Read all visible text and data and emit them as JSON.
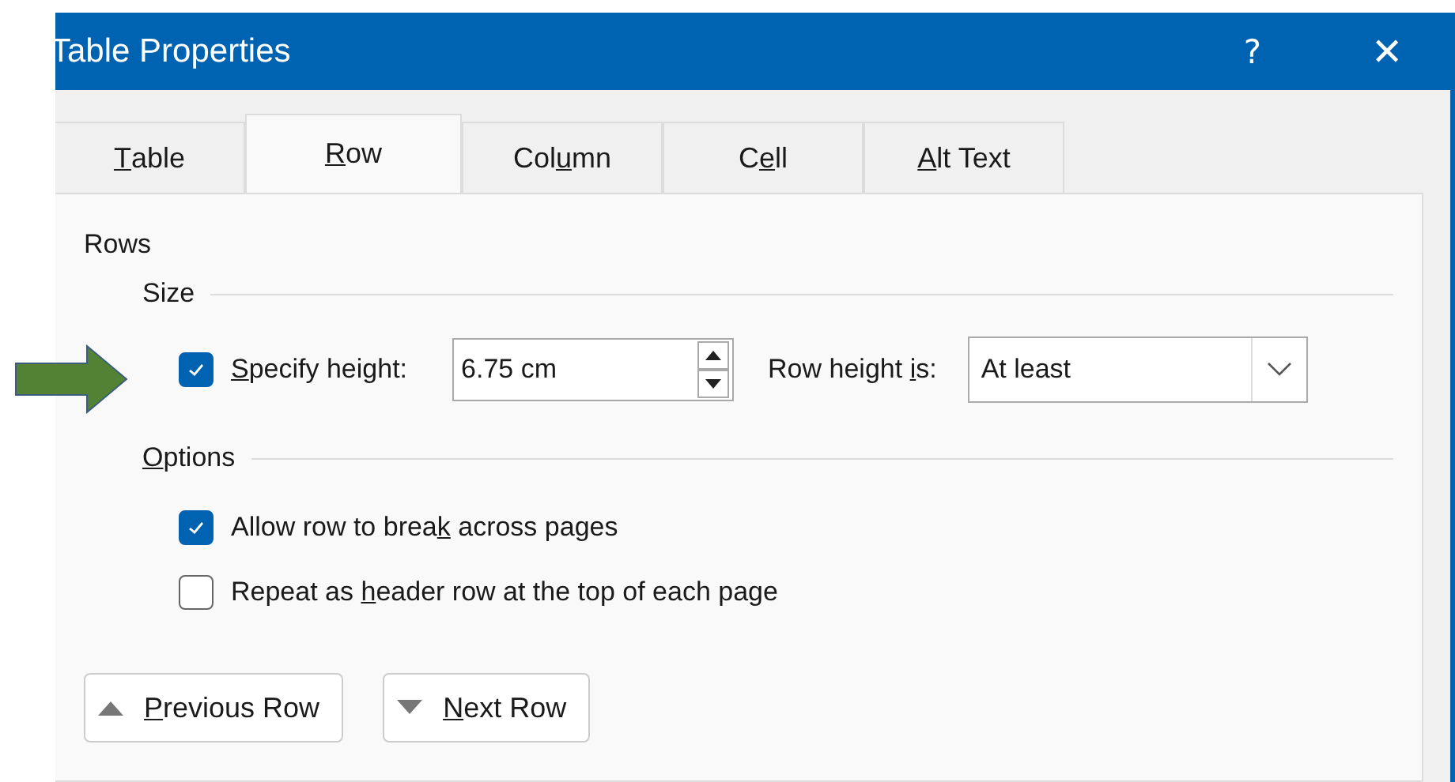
{
  "window": {
    "title": "Table Properties",
    "help": "?",
    "close": "✕"
  },
  "tabs": [
    {
      "key": "T",
      "post": "able",
      "selected": false
    },
    {
      "key": "R",
      "post": "ow",
      "selected": true
    },
    {
      "pre": "Col",
      "key": "u",
      "post": "mn",
      "selected": false
    },
    {
      "pre": "C",
      "key": "e",
      "post": "ll",
      "selected": false
    },
    {
      "key": "A",
      "post": "lt Text",
      "selected": false
    }
  ],
  "section": "Rows",
  "size": {
    "heading": "Size",
    "specify_height": {
      "key": "S",
      "post": "pecify height:",
      "checked": true
    },
    "height_value": "6.75 cm",
    "row_height_label": {
      "pre": "Row height ",
      "key": "i",
      "post": "s:"
    },
    "row_height_mode": "At least"
  },
  "options": {
    "heading": {
      "key": "O",
      "post": "ptions"
    },
    "items": [
      {
        "pre": "Allow row to brea",
        "key": "k",
        "post": " across pages",
        "checked": true
      },
      {
        "pre": "Repeat as ",
        "key": "h",
        "post": "eader row at the top of each page",
        "checked": false
      }
    ]
  },
  "buttons": [
    {
      "key": "P",
      "post": "revious Row",
      "kind": "up"
    },
    {
      "key": "N",
      "post": "ext Row",
      "kind": "down"
    }
  ]
}
